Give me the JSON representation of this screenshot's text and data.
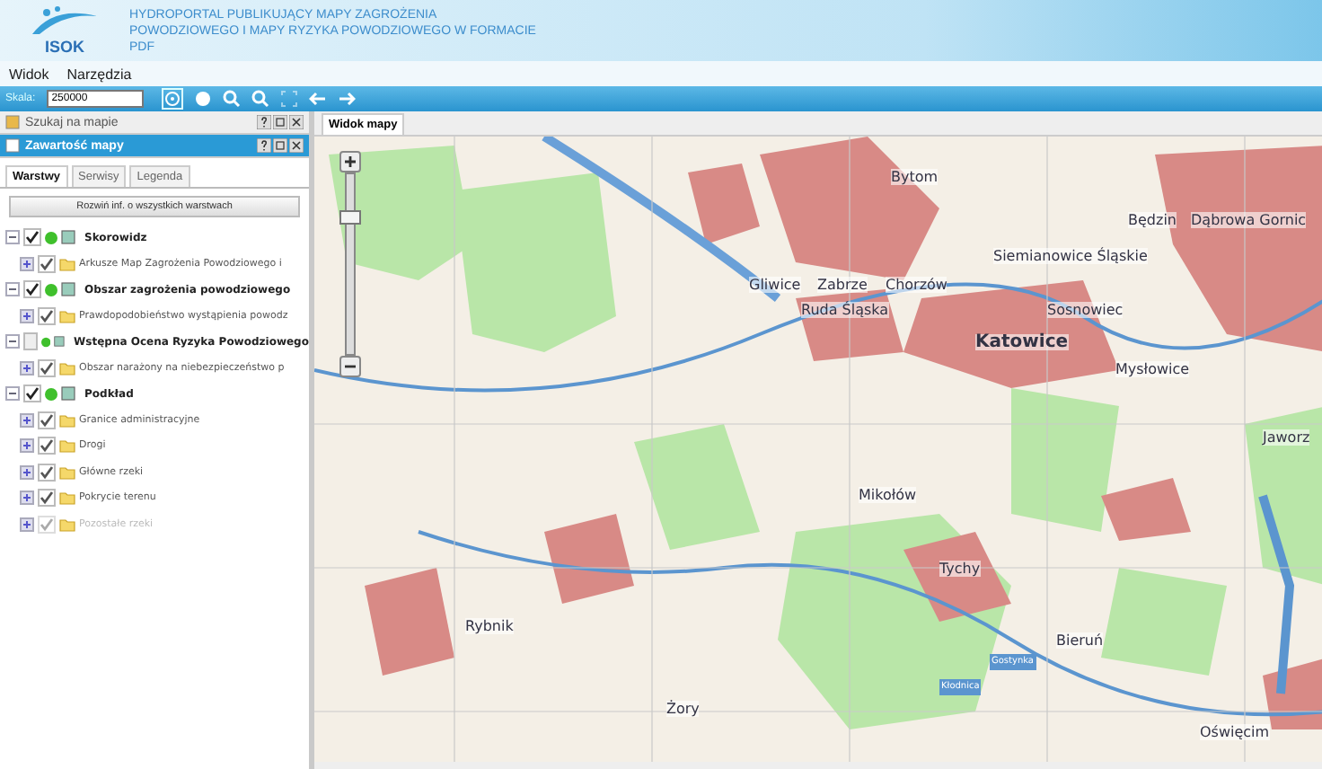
{
  "header": {
    "logo_text": "ISOK",
    "title": "HYDROPORTAL PUBLIKUJĄCY MAPY ZAGROŻENIA POWODZIOWEGO I MAPY RYZYKA POWODZIOWEGO W FORMACIE PDF"
  },
  "menu": [
    "Widok",
    "Narzędzia"
  ],
  "toolbar": {
    "scale_label": "Skala:",
    "scale_value": "250000"
  },
  "panels": [
    {
      "title": "Szukaj na mapie",
      "selected": false
    },
    {
      "title": "Zawartość mapy",
      "selected": true
    }
  ],
  "tabs": [
    {
      "label": "Warstwy",
      "selected": true
    },
    {
      "label": "Serwisy",
      "selected": false
    },
    {
      "label": "Legenda",
      "selected": false
    }
  ],
  "expand_button": "Rozwiń inf. o wszystkich warstwach",
  "layers": [
    {
      "label": "Skorowidz",
      "checked": true,
      "children": [
        {
          "label": "Arkusze Map Zagrożenia Powodziowego i",
          "checked": true,
          "disabled": false
        }
      ]
    },
    {
      "label": "Obszar zagrożenia powodziowego",
      "checked": true,
      "children": [
        {
          "label": "Prawdopodobieństwo wystąpienia powodz",
          "checked": true,
          "disabled": false
        }
      ]
    },
    {
      "label": "Wstępna Ocena Ryzyka Powodziowego",
      "checked": false,
      "children": [
        {
          "label": "Obszar narażony na niebezpieczeństwo p",
          "checked": true,
          "disabled": false
        }
      ]
    },
    {
      "label": "Podkład",
      "checked": true,
      "children": [
        {
          "label": "Granice administracyjne",
          "checked": true,
          "disabled": false
        },
        {
          "label": "Drogi",
          "checked": true,
          "disabled": false
        },
        {
          "label": "Główne rzeki",
          "checked": true,
          "disabled": false
        },
        {
          "label": "Pokrycie terenu",
          "checked": true,
          "disabled": false
        },
        {
          "label": "Pozostałe rzeki",
          "checked": true,
          "disabled": true
        }
      ]
    }
  ],
  "map": {
    "tab": "Widok mapy",
    "zoom": {
      "level": 0.78
    },
    "places": [
      {
        "name": "Bytom",
        "kind": "city"
      },
      {
        "name": "Będzin",
        "kind": "city"
      },
      {
        "name": "Dąbrowa Gornic",
        "kind": "city"
      },
      {
        "name": "Siemianowice Śląskie",
        "kind": "city"
      },
      {
        "name": "Gliwice",
        "kind": "city"
      },
      {
        "name": "Zabrze",
        "kind": "city"
      },
      {
        "name": "Chorzów",
        "kind": "city"
      },
      {
        "name": "Ruda Śląska",
        "kind": "city"
      },
      {
        "name": "Sosnowiec",
        "kind": "city"
      },
      {
        "name": "Katowice",
        "kind": "capital"
      },
      {
        "name": "Mysłowice",
        "kind": "city"
      },
      {
        "name": "Jaworz",
        "kind": "city"
      },
      {
        "name": "Mikołów",
        "kind": "city"
      },
      {
        "name": "Tychy",
        "kind": "city"
      },
      {
        "name": "Rybnik",
        "kind": "city"
      },
      {
        "name": "Bieruń",
        "kind": "city"
      },
      {
        "name": "Gostynka",
        "kind": "river"
      },
      {
        "name": "Kłodnica",
        "kind": "river"
      },
      {
        "name": "Żory",
        "kind": "city"
      },
      {
        "name": "Oświęcim",
        "kind": "city"
      }
    ]
  }
}
